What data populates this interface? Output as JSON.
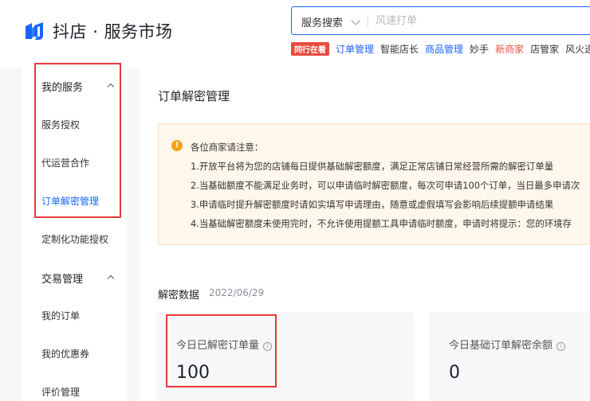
{
  "header": {
    "brand": "抖店",
    "separator": "·",
    "subtitle": "服务市场",
    "search": {
      "type_label": "服务搜索",
      "placeholder": "风速打单"
    },
    "hot_badge": "同行在看",
    "hot_links": [
      {
        "label": "订单管理",
        "color": "#1966ff"
      },
      {
        "label": "智能店长",
        "color": "#333333"
      },
      {
        "label": "商品管理",
        "color": "#1966ff"
      },
      {
        "label": "妙手",
        "color": "#333333"
      },
      {
        "label": "新商家",
        "color": "#e8563d"
      },
      {
        "label": "店管家",
        "color": "#333333"
      },
      {
        "label": "风火递",
        "color": "#333333"
      }
    ]
  },
  "sidebar": {
    "groups": [
      {
        "title": "我的服务",
        "items": [
          {
            "label": "服务授权",
            "active": false
          },
          {
            "label": "代运营合作",
            "active": false
          },
          {
            "label": "订单解密管理",
            "active": true
          },
          {
            "label": "定制化功能授权",
            "active": false
          }
        ]
      },
      {
        "title": "交易管理",
        "items": [
          {
            "label": "我的订单",
            "active": false
          },
          {
            "label": "我的优惠券",
            "active": false
          },
          {
            "label": "评价管理",
            "active": false
          }
        ]
      }
    ]
  },
  "main": {
    "title": "订单解密管理",
    "notice": {
      "heading": "各位商家请注意：",
      "lines": [
        "1.开放平台将为您的店铺每日提供基础解密额度，满足正常店铺日常经营所需的解密订单量",
        "2.当基础额度不能满足业务时，可以申请临时解密额度，每次可申请100个订单，当日最多申请次",
        "3.申请临时提升解密额度时请如实填写申请理由，随意或虚假填写会影响后续提额申请结果",
        "4.当基础解密额度未使用完时，不允许使用提额工具申请临时额度，申请时将提示：您的环境存"
      ]
    },
    "stats": {
      "title": "解密数据",
      "date": "2022/06/29",
      "cards": [
        {
          "label": "今日已解密订单量",
          "value": "100"
        },
        {
          "label": "今日基础订单解密余额",
          "value": "0"
        }
      ]
    }
  },
  "colors": {
    "accent": "#1966ff",
    "highlight_box": "#e63a3a",
    "notice_bg": "#fff7eb",
    "notice_icon": "#f8a01c"
  }
}
